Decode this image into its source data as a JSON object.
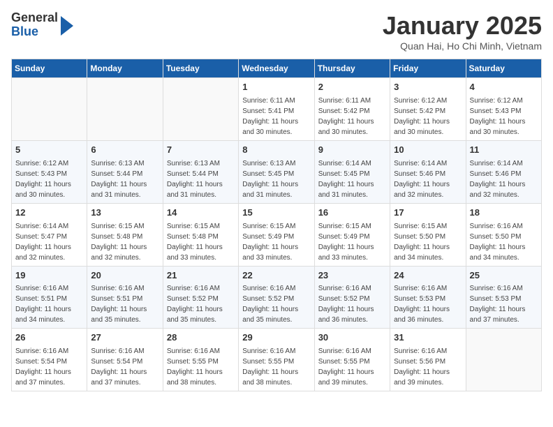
{
  "header": {
    "logo_general": "General",
    "logo_blue": "Blue",
    "title": "January 2025",
    "subtitle": "Quan Hai, Ho Chi Minh, Vietnam"
  },
  "days_of_week": [
    "Sunday",
    "Monday",
    "Tuesday",
    "Wednesday",
    "Thursday",
    "Friday",
    "Saturday"
  ],
  "weeks": [
    {
      "cells": [
        {
          "day": null,
          "info": null
        },
        {
          "day": null,
          "info": null
        },
        {
          "day": null,
          "info": null
        },
        {
          "day": "1",
          "info": "Sunrise: 6:11 AM\nSunset: 5:41 PM\nDaylight: 11 hours\nand 30 minutes."
        },
        {
          "day": "2",
          "info": "Sunrise: 6:11 AM\nSunset: 5:42 PM\nDaylight: 11 hours\nand 30 minutes."
        },
        {
          "day": "3",
          "info": "Sunrise: 6:12 AM\nSunset: 5:42 PM\nDaylight: 11 hours\nand 30 minutes."
        },
        {
          "day": "4",
          "info": "Sunrise: 6:12 AM\nSunset: 5:43 PM\nDaylight: 11 hours\nand 30 minutes."
        }
      ]
    },
    {
      "cells": [
        {
          "day": "5",
          "info": "Sunrise: 6:12 AM\nSunset: 5:43 PM\nDaylight: 11 hours\nand 30 minutes."
        },
        {
          "day": "6",
          "info": "Sunrise: 6:13 AM\nSunset: 5:44 PM\nDaylight: 11 hours\nand 31 minutes."
        },
        {
          "day": "7",
          "info": "Sunrise: 6:13 AM\nSunset: 5:44 PM\nDaylight: 11 hours\nand 31 minutes."
        },
        {
          "day": "8",
          "info": "Sunrise: 6:13 AM\nSunset: 5:45 PM\nDaylight: 11 hours\nand 31 minutes."
        },
        {
          "day": "9",
          "info": "Sunrise: 6:14 AM\nSunset: 5:45 PM\nDaylight: 11 hours\nand 31 minutes."
        },
        {
          "day": "10",
          "info": "Sunrise: 6:14 AM\nSunset: 5:46 PM\nDaylight: 11 hours\nand 32 minutes."
        },
        {
          "day": "11",
          "info": "Sunrise: 6:14 AM\nSunset: 5:46 PM\nDaylight: 11 hours\nand 32 minutes."
        }
      ]
    },
    {
      "cells": [
        {
          "day": "12",
          "info": "Sunrise: 6:14 AM\nSunset: 5:47 PM\nDaylight: 11 hours\nand 32 minutes."
        },
        {
          "day": "13",
          "info": "Sunrise: 6:15 AM\nSunset: 5:48 PM\nDaylight: 11 hours\nand 32 minutes."
        },
        {
          "day": "14",
          "info": "Sunrise: 6:15 AM\nSunset: 5:48 PM\nDaylight: 11 hours\nand 33 minutes."
        },
        {
          "day": "15",
          "info": "Sunrise: 6:15 AM\nSunset: 5:49 PM\nDaylight: 11 hours\nand 33 minutes."
        },
        {
          "day": "16",
          "info": "Sunrise: 6:15 AM\nSunset: 5:49 PM\nDaylight: 11 hours\nand 33 minutes."
        },
        {
          "day": "17",
          "info": "Sunrise: 6:15 AM\nSunset: 5:50 PM\nDaylight: 11 hours\nand 34 minutes."
        },
        {
          "day": "18",
          "info": "Sunrise: 6:16 AM\nSunset: 5:50 PM\nDaylight: 11 hours\nand 34 minutes."
        }
      ]
    },
    {
      "cells": [
        {
          "day": "19",
          "info": "Sunrise: 6:16 AM\nSunset: 5:51 PM\nDaylight: 11 hours\nand 34 minutes."
        },
        {
          "day": "20",
          "info": "Sunrise: 6:16 AM\nSunset: 5:51 PM\nDaylight: 11 hours\nand 35 minutes."
        },
        {
          "day": "21",
          "info": "Sunrise: 6:16 AM\nSunset: 5:52 PM\nDaylight: 11 hours\nand 35 minutes."
        },
        {
          "day": "22",
          "info": "Sunrise: 6:16 AM\nSunset: 5:52 PM\nDaylight: 11 hours\nand 35 minutes."
        },
        {
          "day": "23",
          "info": "Sunrise: 6:16 AM\nSunset: 5:52 PM\nDaylight: 11 hours\nand 36 minutes."
        },
        {
          "day": "24",
          "info": "Sunrise: 6:16 AM\nSunset: 5:53 PM\nDaylight: 11 hours\nand 36 minutes."
        },
        {
          "day": "25",
          "info": "Sunrise: 6:16 AM\nSunset: 5:53 PM\nDaylight: 11 hours\nand 37 minutes."
        }
      ]
    },
    {
      "cells": [
        {
          "day": "26",
          "info": "Sunrise: 6:16 AM\nSunset: 5:54 PM\nDaylight: 11 hours\nand 37 minutes."
        },
        {
          "day": "27",
          "info": "Sunrise: 6:16 AM\nSunset: 5:54 PM\nDaylight: 11 hours\nand 37 minutes."
        },
        {
          "day": "28",
          "info": "Sunrise: 6:16 AM\nSunset: 5:55 PM\nDaylight: 11 hours\nand 38 minutes."
        },
        {
          "day": "29",
          "info": "Sunrise: 6:16 AM\nSunset: 5:55 PM\nDaylight: 11 hours\nand 38 minutes."
        },
        {
          "day": "30",
          "info": "Sunrise: 6:16 AM\nSunset: 5:55 PM\nDaylight: 11 hours\nand 39 minutes."
        },
        {
          "day": "31",
          "info": "Sunrise: 6:16 AM\nSunset: 5:56 PM\nDaylight: 11 hours\nand 39 minutes."
        },
        {
          "day": null,
          "info": null
        }
      ]
    }
  ]
}
